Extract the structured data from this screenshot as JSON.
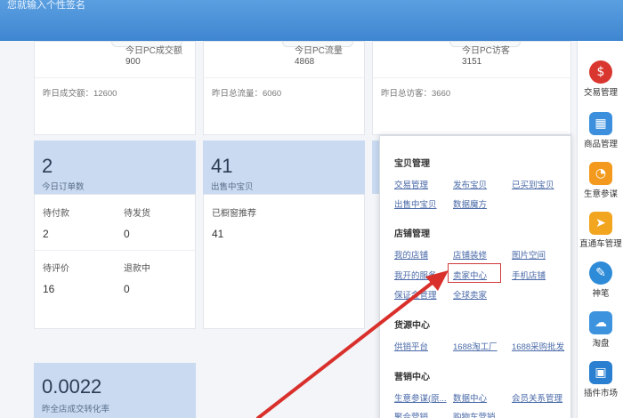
{
  "topbar": {
    "hint": "您就输入个性签名"
  },
  "stats": [
    {
      "label": "今日PC成交额",
      "value": "900",
      "footer": "昨日成交额：12600"
    },
    {
      "label": "今日PC流量",
      "value": "4868",
      "footer": "昨日总流量：6060"
    },
    {
      "label": "今日PC访客",
      "value": "3151",
      "footer": "昨日总访客：3660"
    }
  ],
  "orders": {
    "big": "2",
    "sub": "今日订单数",
    "cells": [
      {
        "label": "待付款",
        "value": "2"
      },
      {
        "label": "待发货",
        "value": "0"
      },
      {
        "label": "待评价",
        "value": "16"
      },
      {
        "label": "退款中",
        "value": "0"
      }
    ]
  },
  "items": {
    "big": "41",
    "sub": "出售中宝贝",
    "cell": {
      "label": "已橱窗推荐",
      "value": "41"
    }
  },
  "conversion": {
    "big": "0.0022",
    "sub": "昨全店成交转化率"
  },
  "popup": {
    "sections": [
      {
        "title": "宝贝管理",
        "links": [
          "交易管理",
          "发布宝贝",
          "已买到宝贝",
          "出售中宝贝",
          "数据魔方"
        ]
      },
      {
        "title": "店铺管理",
        "links": [
          "我的店铺",
          "店铺装修",
          "图片空间",
          "我开的服务",
          "卖家中心",
          "手机店铺",
          "保证金管理",
          "全球卖家"
        ]
      },
      {
        "title": "货源中心",
        "links": [
          "供销平台",
          "1688淘工厂",
          "1688采购批发"
        ]
      },
      {
        "title": "营销中心",
        "links": [
          "生意参谋(原...",
          "数据中心",
          "会员关系管理",
          "聚合营销",
          "购物车营销"
        ]
      }
    ],
    "highlight": "卖家中心",
    "highlight_color": "#d0393b"
  },
  "rail": [
    {
      "label": "交易管理",
      "icon": "money-icon",
      "glyph": "$",
      "color": "#d9362f"
    },
    {
      "label": "商品管理",
      "icon": "goods-icon",
      "glyph": "▦",
      "color": "#3b8fdc"
    },
    {
      "label": "生意参谋",
      "icon": "advisor-icon",
      "glyph": "◔",
      "color": "#f39a1e"
    },
    {
      "label": "直通车管理",
      "icon": "car-icon",
      "glyph": "➤",
      "color": "#f2a51f"
    },
    {
      "label": "神笔",
      "icon": "pen-icon",
      "glyph": "✎",
      "color": "#2d8bd8"
    },
    {
      "label": "淘盘",
      "icon": "cloud-icon",
      "glyph": "☁",
      "color": "#3d93de"
    },
    {
      "label": "插件市场",
      "icon": "plugin-icon",
      "glyph": "▣",
      "color": "#2a7fd0"
    }
  ],
  "colors": {
    "accent": "#3f86d1",
    "tile": "#c9daf1",
    "arrow": "#d9302c"
  }
}
